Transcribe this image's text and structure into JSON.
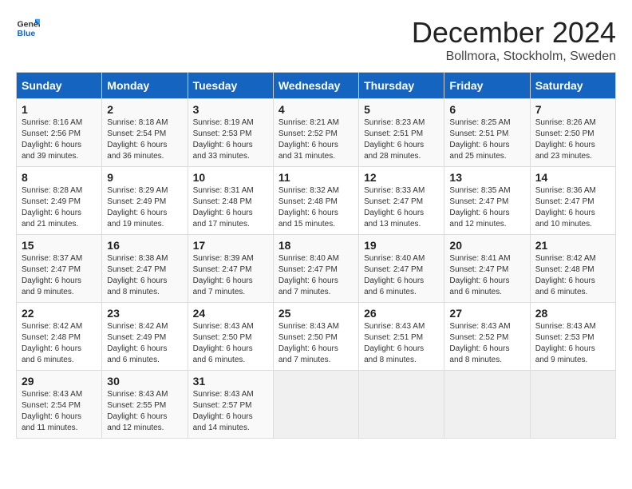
{
  "header": {
    "logo_general": "General",
    "logo_blue": "Blue",
    "month_title": "December 2024",
    "location": "Bollmora, Stockholm, Sweden"
  },
  "days_of_week": [
    "Sunday",
    "Monday",
    "Tuesday",
    "Wednesday",
    "Thursday",
    "Friday",
    "Saturday"
  ],
  "weeks": [
    [
      {
        "day": 1,
        "sunrise": "Sunrise: 8:16 AM",
        "sunset": "Sunset: 2:56 PM",
        "daylight": "Daylight: 6 hours and 39 minutes."
      },
      {
        "day": 2,
        "sunrise": "Sunrise: 8:18 AM",
        "sunset": "Sunset: 2:54 PM",
        "daylight": "Daylight: 6 hours and 36 minutes."
      },
      {
        "day": 3,
        "sunrise": "Sunrise: 8:19 AM",
        "sunset": "Sunset: 2:53 PM",
        "daylight": "Daylight: 6 hours and 33 minutes."
      },
      {
        "day": 4,
        "sunrise": "Sunrise: 8:21 AM",
        "sunset": "Sunset: 2:52 PM",
        "daylight": "Daylight: 6 hours and 31 minutes."
      },
      {
        "day": 5,
        "sunrise": "Sunrise: 8:23 AM",
        "sunset": "Sunset: 2:51 PM",
        "daylight": "Daylight: 6 hours and 28 minutes."
      },
      {
        "day": 6,
        "sunrise": "Sunrise: 8:25 AM",
        "sunset": "Sunset: 2:51 PM",
        "daylight": "Daylight: 6 hours and 25 minutes."
      },
      {
        "day": 7,
        "sunrise": "Sunrise: 8:26 AM",
        "sunset": "Sunset: 2:50 PM",
        "daylight": "Daylight: 6 hours and 23 minutes."
      }
    ],
    [
      {
        "day": 8,
        "sunrise": "Sunrise: 8:28 AM",
        "sunset": "Sunset: 2:49 PM",
        "daylight": "Daylight: 6 hours and 21 minutes."
      },
      {
        "day": 9,
        "sunrise": "Sunrise: 8:29 AM",
        "sunset": "Sunset: 2:49 PM",
        "daylight": "Daylight: 6 hours and 19 minutes."
      },
      {
        "day": 10,
        "sunrise": "Sunrise: 8:31 AM",
        "sunset": "Sunset: 2:48 PM",
        "daylight": "Daylight: 6 hours and 17 minutes."
      },
      {
        "day": 11,
        "sunrise": "Sunrise: 8:32 AM",
        "sunset": "Sunset: 2:48 PM",
        "daylight": "Daylight: 6 hours and 15 minutes."
      },
      {
        "day": 12,
        "sunrise": "Sunrise: 8:33 AM",
        "sunset": "Sunset: 2:47 PM",
        "daylight": "Daylight: 6 hours and 13 minutes."
      },
      {
        "day": 13,
        "sunrise": "Sunrise: 8:35 AM",
        "sunset": "Sunset: 2:47 PM",
        "daylight": "Daylight: 6 hours and 12 minutes."
      },
      {
        "day": 14,
        "sunrise": "Sunrise: 8:36 AM",
        "sunset": "Sunset: 2:47 PM",
        "daylight": "Daylight: 6 hours and 10 minutes."
      }
    ],
    [
      {
        "day": 15,
        "sunrise": "Sunrise: 8:37 AM",
        "sunset": "Sunset: 2:47 PM",
        "daylight": "Daylight: 6 hours and 9 minutes."
      },
      {
        "day": 16,
        "sunrise": "Sunrise: 8:38 AM",
        "sunset": "Sunset: 2:47 PM",
        "daylight": "Daylight: 6 hours and 8 minutes."
      },
      {
        "day": 17,
        "sunrise": "Sunrise: 8:39 AM",
        "sunset": "Sunset: 2:47 PM",
        "daylight": "Daylight: 6 hours and 7 minutes."
      },
      {
        "day": 18,
        "sunrise": "Sunrise: 8:40 AM",
        "sunset": "Sunset: 2:47 PM",
        "daylight": "Daylight: 6 hours and 7 minutes."
      },
      {
        "day": 19,
        "sunrise": "Sunrise: 8:40 AM",
        "sunset": "Sunset: 2:47 PM",
        "daylight": "Daylight: 6 hours and 6 minutes."
      },
      {
        "day": 20,
        "sunrise": "Sunrise: 8:41 AM",
        "sunset": "Sunset: 2:47 PM",
        "daylight": "Daylight: 6 hours and 6 minutes."
      },
      {
        "day": 21,
        "sunrise": "Sunrise: 8:42 AM",
        "sunset": "Sunset: 2:48 PM",
        "daylight": "Daylight: 6 hours and 6 minutes."
      }
    ],
    [
      {
        "day": 22,
        "sunrise": "Sunrise: 8:42 AM",
        "sunset": "Sunset: 2:48 PM",
        "daylight": "Daylight: 6 hours and 6 minutes."
      },
      {
        "day": 23,
        "sunrise": "Sunrise: 8:42 AM",
        "sunset": "Sunset: 2:49 PM",
        "daylight": "Daylight: 6 hours and 6 minutes."
      },
      {
        "day": 24,
        "sunrise": "Sunrise: 8:43 AM",
        "sunset": "Sunset: 2:50 PM",
        "daylight": "Daylight: 6 hours and 6 minutes."
      },
      {
        "day": 25,
        "sunrise": "Sunrise: 8:43 AM",
        "sunset": "Sunset: 2:50 PM",
        "daylight": "Daylight: 6 hours and 7 minutes."
      },
      {
        "day": 26,
        "sunrise": "Sunrise: 8:43 AM",
        "sunset": "Sunset: 2:51 PM",
        "daylight": "Daylight: 6 hours and 8 minutes."
      },
      {
        "day": 27,
        "sunrise": "Sunrise: 8:43 AM",
        "sunset": "Sunset: 2:52 PM",
        "daylight": "Daylight: 6 hours and 8 minutes."
      },
      {
        "day": 28,
        "sunrise": "Sunrise: 8:43 AM",
        "sunset": "Sunset: 2:53 PM",
        "daylight": "Daylight: 6 hours and 9 minutes."
      }
    ],
    [
      {
        "day": 29,
        "sunrise": "Sunrise: 8:43 AM",
        "sunset": "Sunset: 2:54 PM",
        "daylight": "Daylight: 6 hours and 11 minutes."
      },
      {
        "day": 30,
        "sunrise": "Sunrise: 8:43 AM",
        "sunset": "Sunset: 2:55 PM",
        "daylight": "Daylight: 6 hours and 12 minutes."
      },
      {
        "day": 31,
        "sunrise": "Sunrise: 8:43 AM",
        "sunset": "Sunset: 2:57 PM",
        "daylight": "Daylight: 6 hours and 14 minutes."
      },
      null,
      null,
      null,
      null
    ]
  ]
}
